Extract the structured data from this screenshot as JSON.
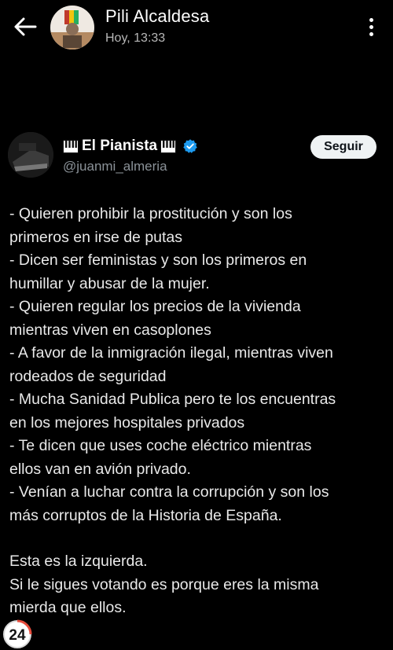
{
  "header": {
    "contact_name": "Pili Alcaldesa",
    "timestamp": "Hoy, 13:33",
    "back_icon": "arrow-left-icon",
    "menu_icon": "more-vertical-icon"
  },
  "tweet": {
    "author": {
      "display_name": "El Pianista",
      "handle": "@juanmi_almeria",
      "emoji_icon": "piano-keys-icon",
      "verified_icon": "verified-badge-icon",
      "verified_color": "#1d9bf0"
    },
    "follow_label": "Seguir",
    "lines": [
      "- Quieren prohibir la prostitución y son los",
      "primeros en irse de putas",
      "- Dicen ser feministas y son los primeros en",
      "humillar y abusar de la mujer.",
      "- Quieren regular los precios de la vivienda",
      "mientras viven en casoplones",
      "- A favor de la inmigración ilegal, mientras viven",
      "rodeados de seguridad",
      "- Mucha Sanidad Publica pero te los encuentras",
      "en los mejores hospitales privados",
      "- Te dicen que uses coche eléctrico mientras",
      "ellos van en avión privado.",
      "- Venían a luchar contra la corrupción y son los",
      "más corruptos de la Historia de España."
    ],
    "closing_lines": [
      "Esta es la izquierda.",
      "Si le sigues votando es porque eres la misma",
      "mierda que ellos."
    ]
  },
  "watermark": {
    "text": "24",
    "icon": "news-24-logo-icon"
  }
}
